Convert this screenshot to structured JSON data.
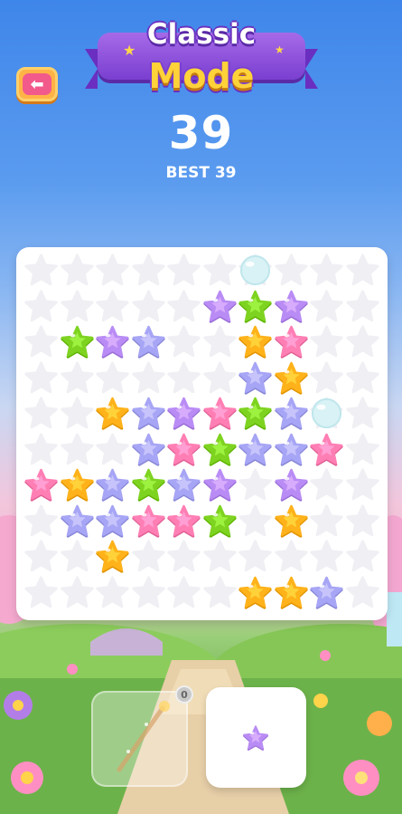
{
  "header": {
    "title_line1": "Classic",
    "title_line2": "Mode",
    "score": "39",
    "best": "BEST 39"
  },
  "icons": {
    "back": "arrow-left-icon",
    "wand": "magic-wand-icon"
  },
  "colors": {
    "green": "#7ed321",
    "pink": "#ff7fb4",
    "purple": "#b98cf5",
    "orange": "#ffb21a",
    "lavender": "#a7a5f5",
    "empty": "#efeff4",
    "bubble": "#d8f2f5"
  },
  "board": {
    "rows": 10,
    "cols": 10,
    "cells": [
      [
        ".",
        ".",
        ".",
        ".",
        ".",
        ".",
        "B",
        ".",
        ".",
        "."
      ],
      [
        ".",
        ".",
        ".",
        ".",
        ".",
        "V",
        "G",
        "V",
        ".",
        "."
      ],
      [
        ".",
        "G",
        "V",
        "L",
        ".",
        ".",
        "O",
        "P",
        ".",
        "."
      ],
      [
        ".",
        ".",
        ".",
        ".",
        ".",
        ".",
        "L",
        "O",
        ".",
        "."
      ],
      [
        ".",
        ".",
        "O",
        "L",
        "V",
        "P",
        "G",
        "L",
        "B",
        "."
      ],
      [
        ".",
        ".",
        ".",
        "L",
        "P",
        "G",
        "L",
        "L",
        "P",
        "."
      ],
      [
        "P",
        "O",
        "L",
        "G",
        "L",
        "V",
        ".",
        "V",
        ".",
        "."
      ],
      [
        ".",
        "L",
        "L",
        "P",
        "P",
        "G",
        ".",
        "O",
        ".",
        "."
      ],
      [
        ".",
        ".",
        "O",
        ".",
        ".",
        ".",
        ".",
        ".",
        ".",
        "."
      ],
      [
        ".",
        ".",
        ".",
        ".",
        ".",
        ".",
        "O",
        "O",
        "L",
        "."
      ]
    ],
    "legend": {
      "G": "green",
      "P": "pink",
      "V": "purple",
      "O": "orange",
      "L": "lavender",
      "B": "bubble"
    }
  },
  "tray": {
    "wand_count": "0",
    "piece_color": "purple"
  }
}
